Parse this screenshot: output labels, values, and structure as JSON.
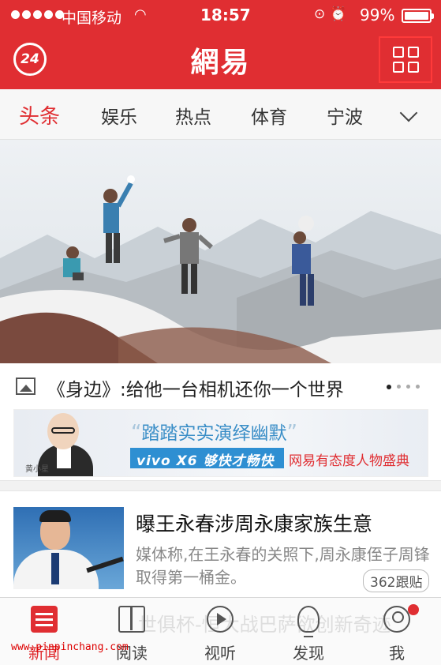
{
  "status_bar": {
    "carrier": "中国移动",
    "time": "18:57",
    "battery": "99%"
  },
  "header": {
    "left_badge": "24",
    "logo": "網易"
  },
  "tabs": [
    {
      "label": "头条",
      "active": true
    },
    {
      "label": "娱乐",
      "active": false
    },
    {
      "label": "热点",
      "active": false
    },
    {
      "label": "体育",
      "active": false
    },
    {
      "label": "宁波",
      "active": false
    }
  ],
  "hero": {
    "caption": "《身边》:给他一台相机还你一个世界",
    "page_index": 1,
    "page_count": 4
  },
  "ad": {
    "headline": "踏踏实实演绎幽默",
    "vivo_text": "vivo X6 够快才畅快",
    "tagline": "网易有态度人物盛典",
    "signature": "黄小星"
  },
  "news": [
    {
      "title": "曝王永春涉周永康家族生意",
      "desc": "媒体称,在王永春的关照下,周永康侄子周锋取得第一桶金。",
      "replies": "362跟贴"
    }
  ],
  "tabbar": {
    "under_text": "世俱杯-恒大战巴萨欲创新奇迹",
    "items": [
      {
        "label": "新闻",
        "icon": "news-icon",
        "active": true
      },
      {
        "label": "阅读",
        "icon": "book-icon",
        "active": false
      },
      {
        "label": "视听",
        "icon": "play-icon",
        "active": false
      },
      {
        "label": "发现",
        "icon": "bulb-icon",
        "active": false
      },
      {
        "label": "我",
        "icon": "user-icon",
        "active": false
      }
    ]
  },
  "watermark": "www.pinpinchang.com",
  "colors": {
    "brand": "#e02e32",
    "ad_blue": "#2e8fd2"
  }
}
